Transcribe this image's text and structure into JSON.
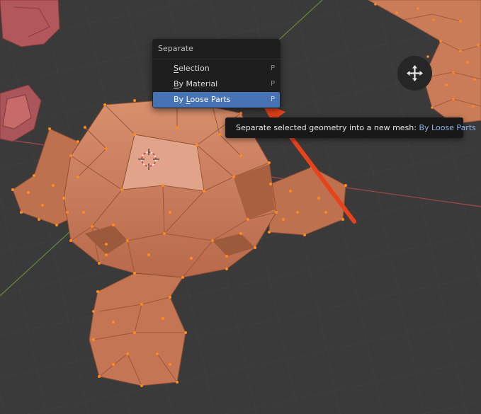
{
  "menu": {
    "title": "Separate",
    "items": [
      {
        "mnemonic": "S",
        "label_rest": "election",
        "shortcut": "P"
      },
      {
        "mnemonic": "B",
        "label_rest": "y Material",
        "shortcut": "P"
      },
      {
        "label_pre": "By ",
        "mnemonic": "L",
        "label_rest": "oose Parts",
        "shortcut": "P"
      }
    ],
    "active_index": 2
  },
  "tooltip": {
    "text": "Separate selected geometry into a new mesh: ",
    "value": "By Loose Parts"
  },
  "colors": {
    "background": "#3a3a3a",
    "menu_bg": "#1e1e1e",
    "highlight": "#4772b3",
    "mesh_face": "#c97a58",
    "vertex": "#ff8a1e",
    "arrow": "#e8421c",
    "x_axis": "#b04a4a",
    "y_axis": "#6a8f34"
  },
  "icons": {
    "gizmo": "move-icon",
    "cursor": "3d-cursor-icon"
  }
}
